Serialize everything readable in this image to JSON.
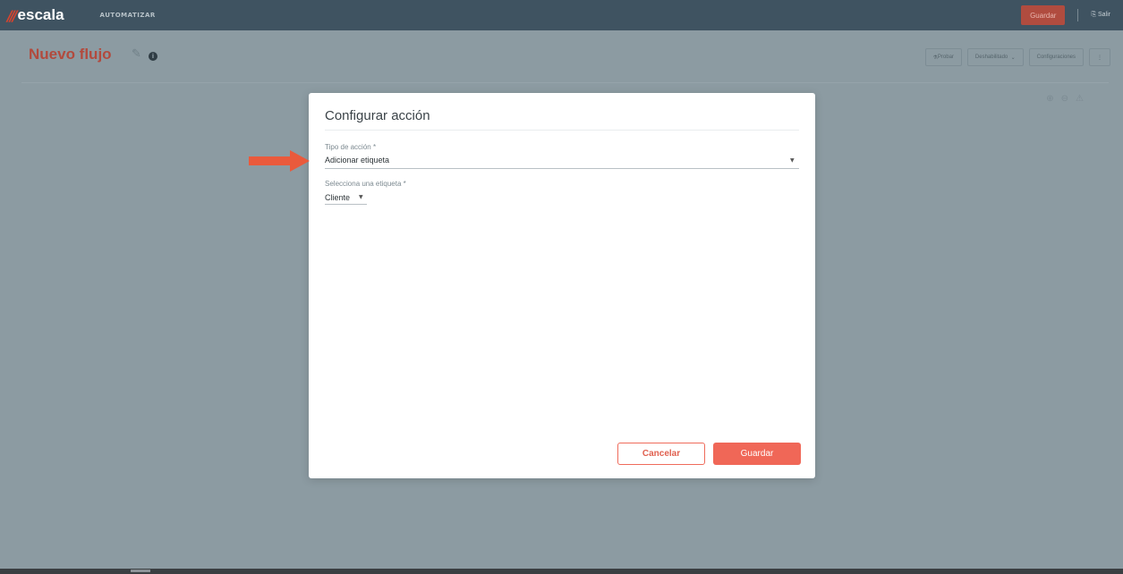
{
  "app": {
    "logo_text": "escala",
    "nav_item": "AUTOMATIZAR",
    "save_label": "Guardar",
    "logout_label": "Salir"
  },
  "page": {
    "title": "Nuevo flujo",
    "toolbar": {
      "test_label": "Probar",
      "status_label": "Deshabilitado",
      "settings_label": "Configuraciones",
      "more_label": "⋮"
    }
  },
  "modal": {
    "title": "Configurar acción",
    "action_type": {
      "label": "Tipo de acción *",
      "value": "Adicionar etiqueta"
    },
    "tag": {
      "label": "Selecciona una etiqueta *",
      "value": "Cliente"
    },
    "cancel_label": "Cancelar",
    "save_label": "Guardar"
  },
  "colors": {
    "accent": "#f06757",
    "arrow": "#ea5a3c",
    "topbar": "#3f5361"
  }
}
